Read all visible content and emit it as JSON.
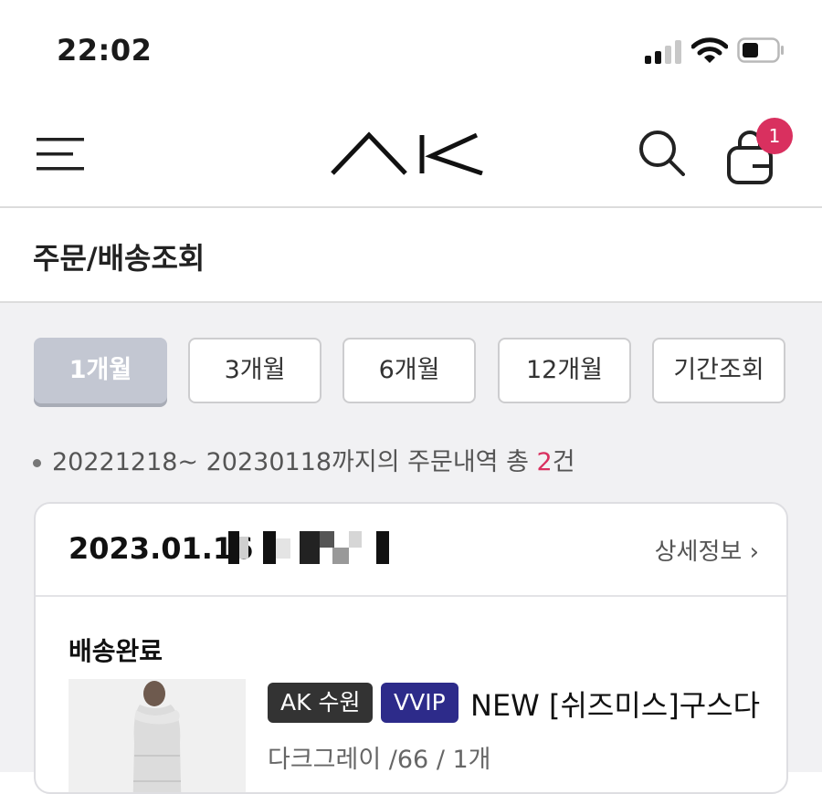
{
  "status_bar": {
    "time": "22:02"
  },
  "header": {
    "menu_icon": "hamburger-menu-icon",
    "logo_text": "AK",
    "search_icon": "search-icon",
    "cart_icon": "shopping-bag-icon",
    "cart_badge": "1"
  },
  "page": {
    "title": "주문/배송조회"
  },
  "period_filter": {
    "options": [
      {
        "label": "1개월",
        "active": true
      },
      {
        "label": "3개월",
        "active": false
      },
      {
        "label": "6개월",
        "active": false
      },
      {
        "label": "12개월",
        "active": false
      },
      {
        "label": "기간조회",
        "active": false
      }
    ]
  },
  "summary": {
    "prefix": "20221218~ 20230118까지의 주문내역 총 ",
    "count": "2",
    "suffix": "건"
  },
  "orders": [
    {
      "date": "2023.01.16",
      "detail_link": "상세정보",
      "status": "배송완료",
      "store_tag": "AK 수원",
      "grade_tag": "VVIP",
      "product_name": "NEW [쉬즈미스]구스다",
      "option": "다크그레이 /66 / 1개"
    }
  ],
  "colors": {
    "accent": "#d9305f",
    "active_period_bg": "#c3c7d2",
    "vvip_tag": "#2d2b8a",
    "store_tag": "#333333"
  }
}
